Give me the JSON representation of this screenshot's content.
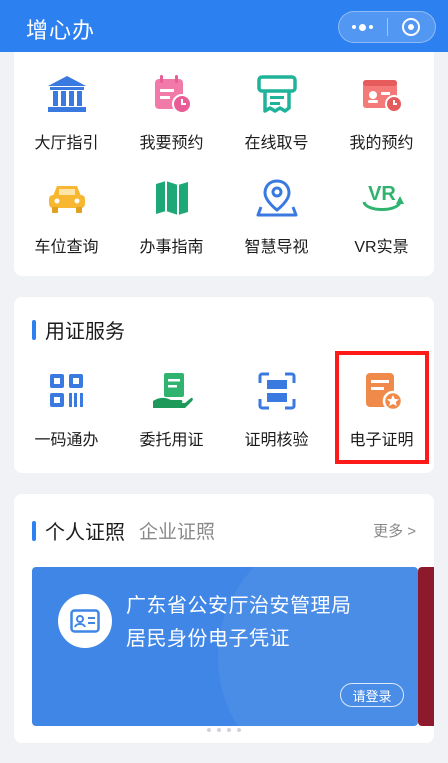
{
  "header": {
    "title": "增心办"
  },
  "services": [
    {
      "label": "大厅指引",
      "icon": "bank-building-icon"
    },
    {
      "label": "我要预约",
      "icon": "calendar-clock-icon"
    },
    {
      "label": "在线取号",
      "icon": "ticket-machine-icon"
    },
    {
      "label": "我的预约",
      "icon": "id-card-clock-icon"
    },
    {
      "label": "车位查询",
      "icon": "car-icon"
    },
    {
      "label": "办事指南",
      "icon": "map-icon"
    },
    {
      "label": "智慧导视",
      "icon": "location-pin-icon"
    },
    {
      "label": "VR实景",
      "icon": "vr-icon"
    }
  ],
  "cert_section": {
    "title": "用证服务",
    "items": [
      {
        "label": "一码通办",
        "icon": "qr-code-icon"
      },
      {
        "label": "委托用证",
        "icon": "hand-document-icon"
      },
      {
        "label": "证明核验",
        "icon": "scan-verify-icon"
      },
      {
        "label": "电子证明",
        "icon": "e-certificate-icon"
      }
    ]
  },
  "credentials": {
    "tab_active": "个人证照",
    "tab_inactive": "企业证照",
    "more": "更多 >",
    "card_line1": "广东省公安厅治安管理局",
    "card_line2": "居民身份电子凭证",
    "login": "请登录"
  },
  "colors": {
    "primary": "#2d80f0",
    "highlight": "#ff1a1a",
    "card": "#3f86e6"
  }
}
